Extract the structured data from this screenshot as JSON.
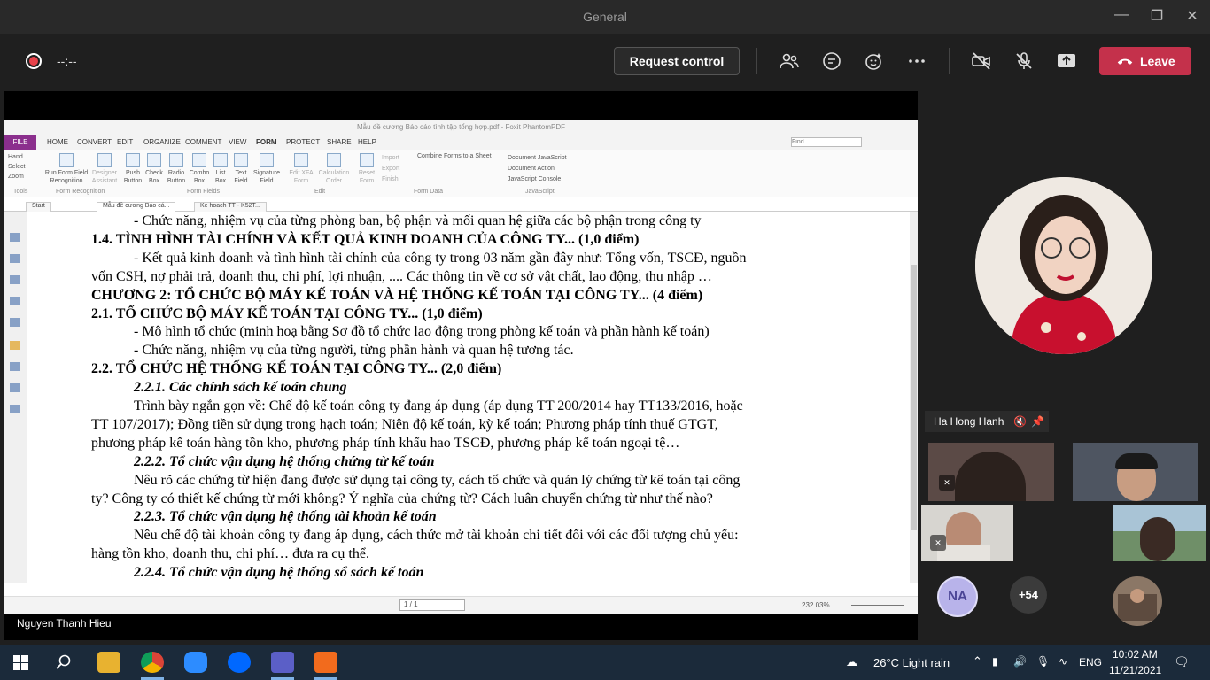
{
  "window": {
    "title": "General"
  },
  "toolbar": {
    "timer": "--:--",
    "request_control_label": "Request control",
    "leave_label": "Leave"
  },
  "foxit": {
    "title": "Mẫu đề cương Báo cáo tình tập tổng hợp.pdf - Foxit PhantomPDF",
    "file_tab": "FILE",
    "menu_tabs": [
      "HOME",
      "CONVERT",
      "EDIT",
      "ORGANIZE",
      "COMMENT",
      "VIEW",
      "FORM",
      "PROTECT",
      "SHARE",
      "HELP"
    ],
    "search_placeholder": "Find",
    "tools": [
      "Hand",
      "Select",
      "Zoom"
    ],
    "ribbon_buttons": [
      "Run Form Field Recognition",
      "Designer Assistant",
      "Push Button",
      "Check Box",
      "Radio Button",
      "Combo Box",
      "List Box",
      "Text Field",
      "Signature Field",
      "Edit XFA Form",
      "Calculation Order",
      "Reset Form",
      "Import",
      "Export",
      "Finish",
      "Combine Forms to a Sheet",
      "Document JavaScript",
      "Document Action",
      "JavaScript Console"
    ],
    "groups": [
      "Tools",
      "Form Recognition",
      "Form Fields",
      "Edit",
      "Form Data",
      "JavaScript"
    ],
    "doc_tabs": [
      "Start",
      "Mẫu đề cương Báo cá...",
      "Ke hoach TT - K52T..."
    ],
    "page_indicator": "1 / 1",
    "zoom": "232.03%"
  },
  "document": {
    "lines": [
      {
        "text": "- Chức năng, nhiệm vụ của từng phòng ban, bộ phận và mối quan hệ giữa các bộ phận trong công ty",
        "style": "normal",
        "indent": 48
      },
      {
        "text": "1.4. TÌNH HÌNH TÀI CHÍNH VÀ KẾT QUẢ KINH DOANH CỦA CÔNG TY... (1,0 điểm)",
        "style": "bold",
        "indent": 0
      },
      {
        "text": "- Kết quả kinh doanh và tình hình tài chính của công ty trong 03 năm gần đây như: Tổng vốn, TSCĐ, nguồn",
        "style": "normal",
        "indent": 48
      },
      {
        "text": "vốn CSH, nợ phải trả, doanh thu, chi phí, lợi nhuận, .... Các thông tin về cơ sở vật chất, lao động, thu nhập …",
        "style": "normal",
        "indent": 0
      },
      {
        "text": "CHƯƠNG 2: TỔ CHỨC BỘ MÁY KẾ TOÁN VÀ HỆ THỐNG KẾ TOÁN TẠI CÔNG TY... (4 điểm)",
        "style": "bold",
        "indent": 0
      },
      {
        "text": "2.1. TỔ CHỨC BỘ MÁY KẾ TOÁN TẠI CÔNG TY... (1,0 điểm)",
        "style": "bold",
        "indent": 0
      },
      {
        "text": "- Mô hình tổ chức (minh hoạ bằng Sơ đồ tổ chức lao động trong phòng kế toán và phần hành kế toán)",
        "style": "normal",
        "indent": 48
      },
      {
        "text": "- Chức năng, nhiệm vụ của từng người, từng phần hành và quan hệ tương tác.",
        "style": "normal",
        "indent": 48
      },
      {
        "text": "2.2. TỔ CHỨC HỆ THỐNG KẾ TOÁN TẠI CÔNG TY... (2,0 điểm)",
        "style": "bold",
        "indent": 0
      },
      {
        "text": "2.2.1. Các chính sách kế toán chung",
        "style": "bi",
        "indent": 48
      },
      {
        "text": "Trình bày ngắn gọn về: Chế độ kế toán công ty đang áp dụng (áp dụng TT 200/2014 hay TT133/2016, hoặc",
        "style": "normal",
        "indent": 48
      },
      {
        "text": "TT 107/2017); Đồng tiền sử dụng trong hạch toán; Niên độ kế toán, kỳ kế toán; Phương pháp tính thuế GTGT,",
        "style": "normal",
        "indent": 0
      },
      {
        "text": "phương pháp kế toán hàng tồn kho, phương pháp tính khấu hao TSCĐ, phương pháp kế toán ngoại tệ…",
        "style": "normal",
        "indent": 0
      },
      {
        "text": "2.2.2. Tổ chức vận dụng hệ thống chứng từ kế toán",
        "style": "bi",
        "indent": 48
      },
      {
        "text": "Nêu rõ các chứng từ hiện đang được sử dụng tại công ty, cách tổ chức và quản lý chứng từ kế toán tại công",
        "style": "normal",
        "indent": 48
      },
      {
        "text": "ty? Công ty có thiết kế chứng từ mới không? Ý nghĩa của chứng từ? Cách luân chuyển chứng từ như thế nào?",
        "style": "normal",
        "indent": 0
      },
      {
        "text": "2.2.3. Tổ chức vận dụng hệ thống tài khoản kế toán",
        "style": "bi",
        "indent": 48
      },
      {
        "text": "Nêu chế độ tài khoản công ty đang áp dụng, cách thức mở tài khoản chi tiết đối với các đối tượng chủ yếu:",
        "style": "normal",
        "indent": 48
      },
      {
        "text": "hàng tồn kho, doanh thu, chi phí… đưa ra cụ thể.",
        "style": "normal",
        "indent": 0
      },
      {
        "text": "2.2.4. Tổ chức vận dụng hệ thống sổ sách kế toán",
        "style": "bi",
        "indent": 48
      }
    ]
  },
  "presenter": {
    "name": "Nguyen Thanh Hieu"
  },
  "pinned": {
    "name": "Ha Hong Hanh"
  },
  "participants": {
    "initials": "NA",
    "overflow": "+54"
  },
  "taskbar": {
    "weather": "26°C  Light rain",
    "lang": "ENG",
    "time": "10:02 AM",
    "date": "11/21/2021"
  },
  "colors": {
    "leave": "#c4314b",
    "record": "#e8434b",
    "foxit_file": "#8b2f8d"
  }
}
